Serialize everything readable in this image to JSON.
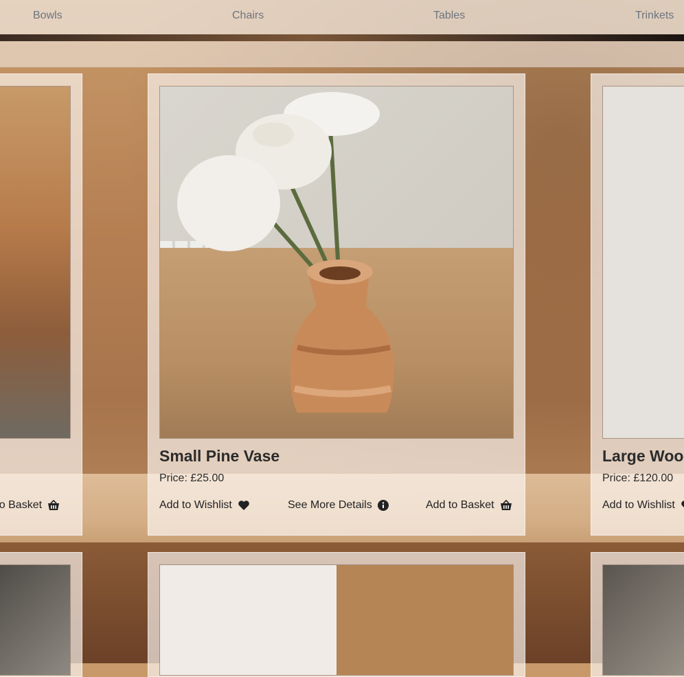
{
  "nav": {
    "items": [
      "Bowls",
      "Chairs",
      "Tables",
      "Trinkets"
    ]
  },
  "products": [
    {
      "title": "",
      "price": "",
      "wishlist_label": "",
      "details_label": "",
      "basket_label": "d to Basket"
    },
    {
      "title": "Small Pine Vase",
      "price": "Price: £25.00",
      "wishlist_label": "Add to Wishlist",
      "details_label": "See More Details",
      "basket_label": "Add to Basket"
    },
    {
      "title": "Large Woo",
      "price": "Price: £120.00",
      "wishlist_label": "Add to Wishlist",
      "details_label": "",
      "basket_label": ""
    }
  ],
  "colors": {
    "nav_text": "#6c757d",
    "card_bg": "#fcf6f2",
    "text": "#222222"
  },
  "icons": {
    "wishlist": "heart-icon",
    "details": "info-circle-icon",
    "basket": "basket-icon"
  }
}
